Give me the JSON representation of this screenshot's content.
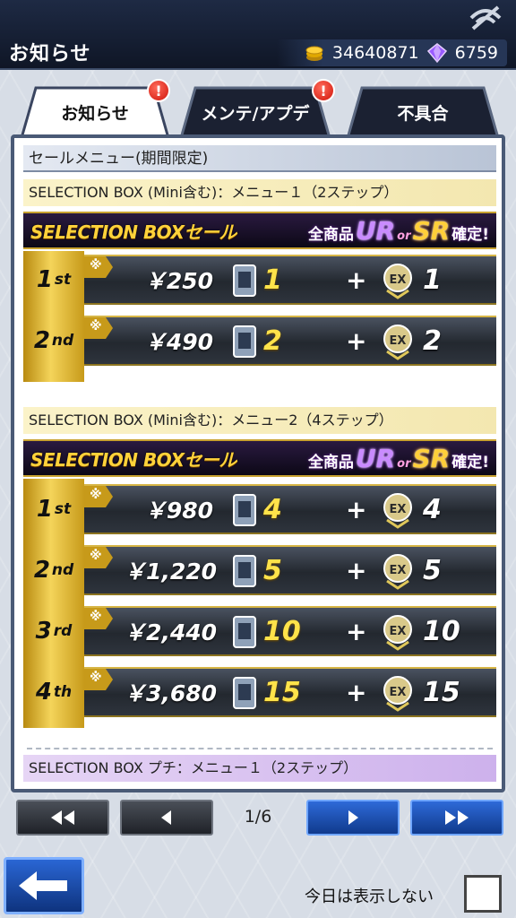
{
  "header": {
    "title": "お知らせ",
    "coins": "34640871",
    "gems": "6759"
  },
  "tabs": [
    {
      "label": "お知らせ",
      "active": true,
      "badge": "!"
    },
    {
      "label": "メンテ/アプデ",
      "active": false,
      "badge": "!"
    },
    {
      "label": "不具合",
      "active": false,
      "badge": ""
    }
  ],
  "content": {
    "section_title": "セールメニュー(期間限定)",
    "menus": [
      {
        "label": "SELECTION BOX (Mini含む)：メニュー１（2ステップ）",
        "banner": {
          "left": "SELECTION BOXセール",
          "g1": "全商品",
          "ur": "UR",
          "or": "or",
          "sr": "SR",
          "g2": "確定!"
        },
        "rows": [
          {
            "step_num": "1",
            "step_suffix": "st",
            "mark": "※",
            "price": "￥250",
            "qty1": "1",
            "plus": "+",
            "qty2": "1"
          },
          {
            "step_num": "2",
            "step_suffix": "nd",
            "mark": "※",
            "price": "￥490",
            "qty1": "2",
            "plus": "+",
            "qty2": "2"
          }
        ]
      },
      {
        "label": "SELECTION BOX (Mini含む)：メニュー2（4ステップ）",
        "banner": {
          "left": "SELECTION BOXセール",
          "g1": "全商品",
          "ur": "UR",
          "or": "or",
          "sr": "SR",
          "g2": "確定!"
        },
        "rows": [
          {
            "step_num": "1",
            "step_suffix": "st",
            "mark": "※",
            "price": "￥980",
            "qty1": "4",
            "plus": "+",
            "qty2": "4"
          },
          {
            "step_num": "2",
            "step_suffix": "nd",
            "mark": "※",
            "price": "￥1,220",
            "qty1": "5",
            "plus": "+",
            "qty2": "5"
          },
          {
            "step_num": "3",
            "step_suffix": "rd",
            "mark": "※",
            "price": "￥2,440",
            "qty1": "10",
            "plus": "+",
            "qty2": "10"
          },
          {
            "step_num": "4",
            "step_suffix": "th",
            "mark": "※",
            "price": "￥3,680",
            "qty1": "15",
            "plus": "+",
            "qty2": "15"
          }
        ]
      },
      {
        "label": "SELECTION BOX プチ：メニュー１（2ステップ）"
      }
    ]
  },
  "pagination": {
    "page": "1/6"
  },
  "footer": {
    "hide_today": "今日は表示しない"
  },
  "colors": {
    "accent_gold": "#ffd23a",
    "ur_purple": "#c98bff",
    "badge_red": "#d0140a",
    "nav_blue": "#2e6ad8"
  }
}
